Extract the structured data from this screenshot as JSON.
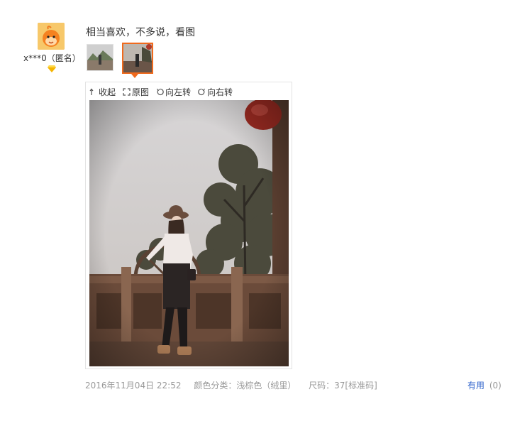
{
  "review": {
    "user_name": "x***0（匿名）",
    "text": "相当喜欢，不多说，看图",
    "date": "2016年11月04日 22:52",
    "color": "颜色分类：浅棕色（绒里）",
    "size": "尺码：37[标准码]",
    "useful_label": "有用",
    "useful_count": "(0)"
  },
  "viewer": {
    "collapse_label": "收起",
    "original_label": "原图",
    "rotate_left_label": "向左转",
    "rotate_right_label": "向右转"
  },
  "colors": {
    "accent": "#f06a1d",
    "link": "#3366cc",
    "muted": "#999999"
  }
}
